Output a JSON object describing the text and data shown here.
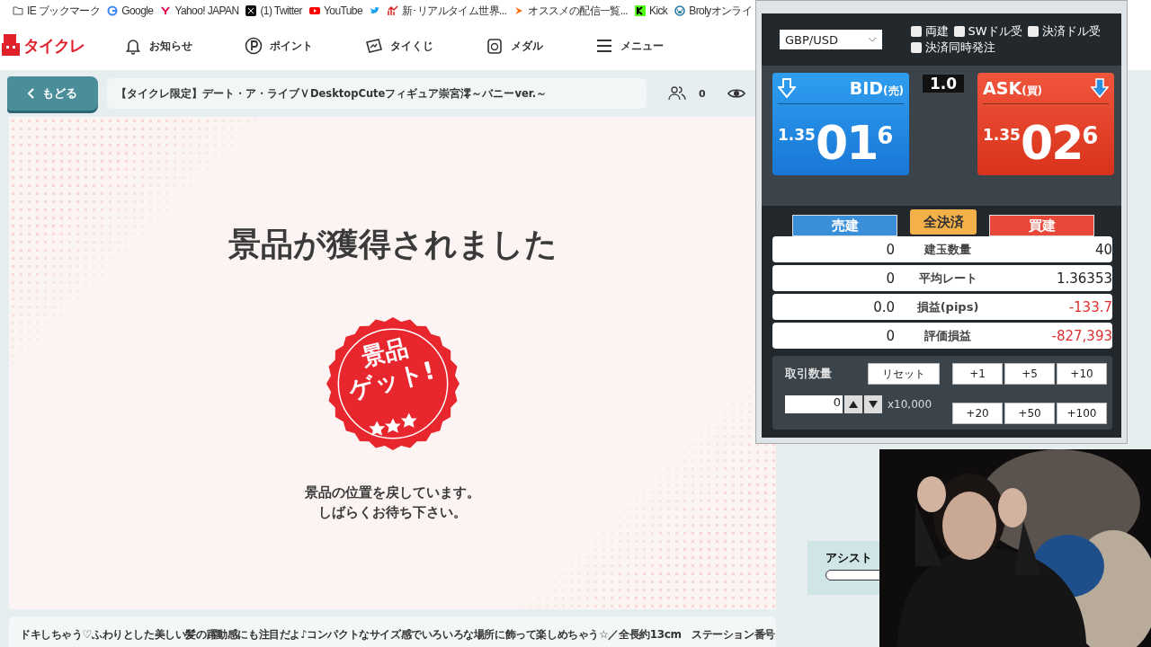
{
  "bookmarks": [
    "IE ブックマーク",
    "Google",
    "Yahoo! JAPAN",
    "(1) Twitter",
    "YouTube",
    "新･リアルタイム世界...",
    "オススメの配信一覧...",
    "Kick",
    "Brolyオンライ"
  ],
  "site": {
    "logo": "タイクレ",
    "nav": [
      "お知らせ",
      "ポイント",
      "タイくじ",
      "メダル",
      "メニュー"
    ]
  },
  "title_bar": {
    "back": "もどる",
    "title": "【タイクレ限定】デート・ア・ライブＶDesktopCuteフィギュア崇宮澪～バニーver.～",
    "viewers": "0"
  },
  "result": {
    "heading": "景品が獲得されました",
    "badge_lines": [
      "景品",
      "ゲット!"
    ],
    "message_lines": [
      "景品の位置を戻しています。",
      "しばらくお待ち下さい。"
    ]
  },
  "description": "ドキしちゃう♡ふわりとした美しい髪の躍動感にも注目だよ♪コンパクトなサイズ感でいろいろな場所に飾って楽しめちゃう☆／全長約13cm　ステーション番号",
  "side_panel": {
    "label": "アシスト"
  },
  "trader": {
    "pair": "GBP/USD",
    "options": [
      {
        "label": "両建",
        "checked": false
      },
      {
        "label": "SWドル受",
        "checked": false
      },
      {
        "label": "決済ドル受",
        "checked": false
      },
      {
        "label": "決済同時発注",
        "checked": false
      }
    ],
    "spread": "1.0",
    "quotes": [
      {
        "kind": "bid",
        "label": "BID",
        "sub": "(売)",
        "prefix": "1.35",
        "big": "01",
        "pip": "6"
      },
      {
        "kind": "ask",
        "label": "ASK",
        "sub": "(買)",
        "prefix": "1.35",
        "big": "02",
        "pip": "6"
      }
    ],
    "tabs": [
      {
        "kind": "sell",
        "label": "売建"
      },
      {
        "kind": "all",
        "label": "全決済"
      },
      {
        "kind": "buy",
        "label": "買建"
      }
    ],
    "rows": [
      {
        "sell": "0",
        "label": "建玉数量",
        "buy": "40",
        "loss": false
      },
      {
        "sell": "0",
        "label": "平均レート",
        "buy": "1.36353",
        "loss": false
      },
      {
        "sell": "0.0",
        "label": "損益(pips)",
        "buy": "-133.7",
        "loss": true
      },
      {
        "sell": "0",
        "label": "評価損益",
        "buy": "-827,393",
        "loss": true
      }
    ],
    "qty_label": "取引数量",
    "reset": "リセット",
    "qty": "0",
    "unit": "x10,000",
    "increments": [
      "+1",
      "+5",
      "+10",
      "+20",
      "+50",
      "+100"
    ]
  }
}
